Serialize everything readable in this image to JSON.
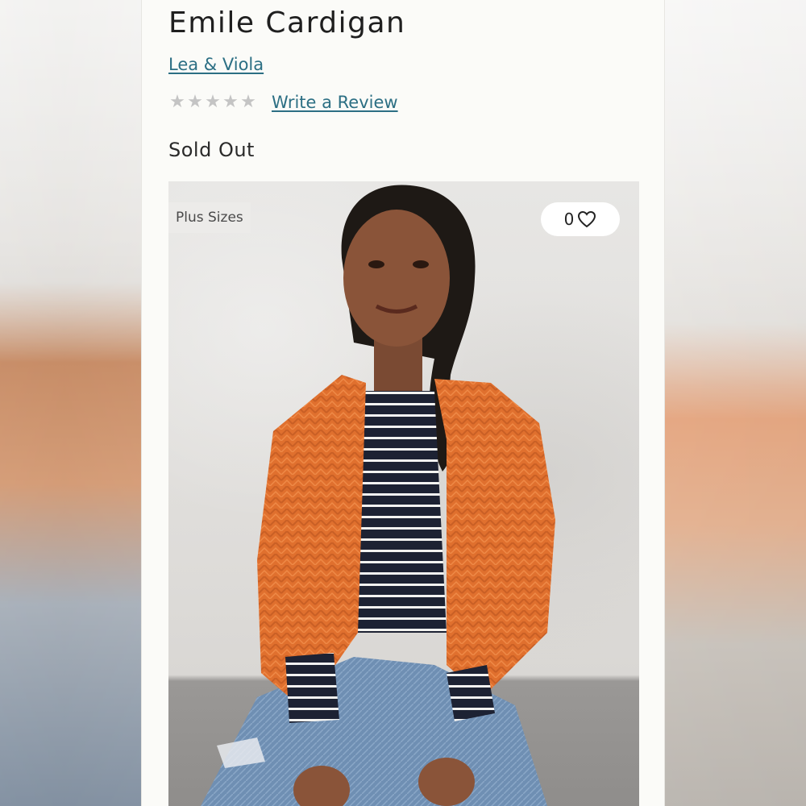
{
  "product": {
    "title": "Emile Cardigan",
    "brand": "Lea & Viola",
    "rating": {
      "stars_filled": 0,
      "stars_total": 5,
      "star_glyph": "★"
    },
    "review_link": "Write a Review",
    "status": "Sold Out"
  },
  "image": {
    "badge": "Plus Sizes",
    "favorite_count": "0",
    "icons": {
      "favorite": "heart-outline-icon"
    }
  },
  "colors": {
    "link": "#2c6f84",
    "text": "#1f1f1f",
    "star_empty": "#c4c4c4",
    "cardigan_orange": "#e0702e",
    "stripe_navy": "#1d2233"
  }
}
